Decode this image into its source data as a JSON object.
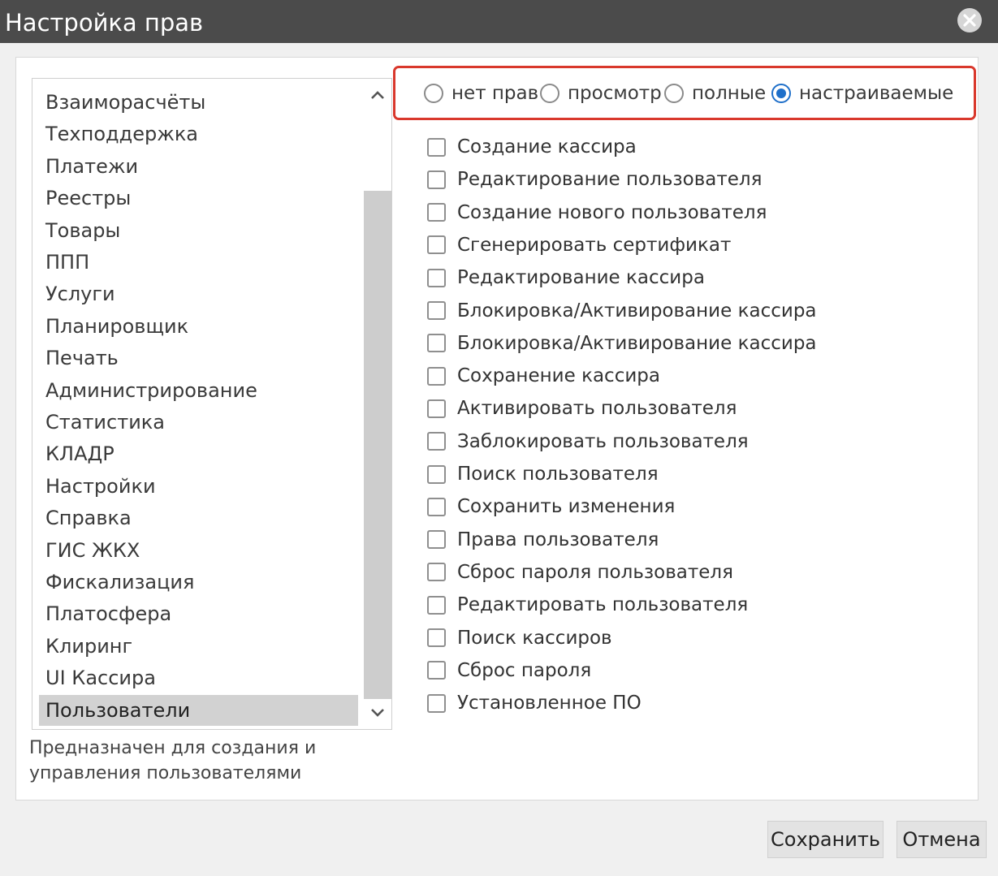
{
  "dialog": {
    "title": "Настройка прав",
    "close_icon": "close-icon"
  },
  "sections": {
    "items": [
      "Взаиморасчёты",
      "Техподдержка",
      "Платежи",
      "Реестры",
      "Товары",
      "ППП",
      "Услуги",
      "Планировщик",
      "Печать",
      "Администрирование",
      "Статистика",
      "КЛАДР",
      "Настройки",
      "Справка",
      "ГИС ЖКХ",
      "Фискализация",
      "Платосфера",
      "Клиринг",
      "UI Кассира",
      "Пользователи"
    ],
    "selected": "Пользователи",
    "description": "Предназначен для создания и управления пользователями"
  },
  "access_level": {
    "options": [
      "нет прав",
      "просмотр",
      "полные",
      "настраиваемые"
    ],
    "selected": "настраиваемые",
    "highlight_color": "#d9382c",
    "accent_color": "#1e6fc9"
  },
  "permissions": [
    {
      "label": "Создание кассира",
      "checked": false
    },
    {
      "label": "Редактирование пользователя",
      "checked": false
    },
    {
      "label": "Создание нового пользователя",
      "checked": false
    },
    {
      "label": "Сгенерировать сертификат",
      "checked": false
    },
    {
      "label": "Редактирование кассира",
      "checked": false
    },
    {
      "label": "Блокировка/Активирование кассира",
      "checked": false
    },
    {
      "label": "Блокировка/Активирование кассира",
      "checked": false
    },
    {
      "label": "Сохранение кассира",
      "checked": false
    },
    {
      "label": "Активировать пользователя",
      "checked": false
    },
    {
      "label": "Заблокировать пользователя",
      "checked": false
    },
    {
      "label": "Поиск пользователя",
      "checked": false
    },
    {
      "label": "Сохранить изменения",
      "checked": false
    },
    {
      "label": "Права пользователя",
      "checked": false
    },
    {
      "label": "Сброс пароля пользователя",
      "checked": false
    },
    {
      "label": "Редактировать пользователя",
      "checked": false
    },
    {
      "label": "Поиск кассиров",
      "checked": false
    },
    {
      "label": "Сброс пароля",
      "checked": false
    },
    {
      "label": "Установленное ПО",
      "checked": false
    }
  ],
  "footer": {
    "save_label": "Сохранить",
    "cancel_label": "Отмена"
  }
}
